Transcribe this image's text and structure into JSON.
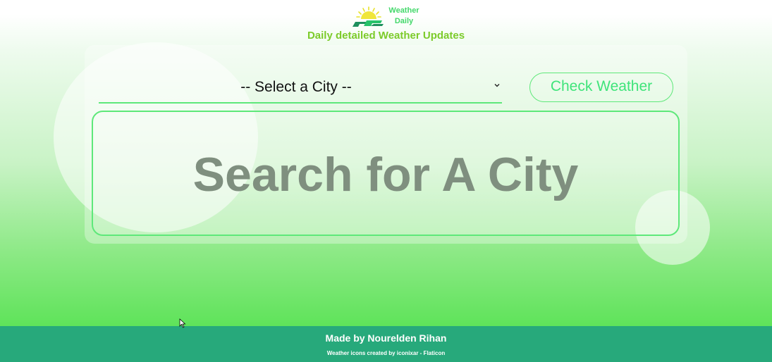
{
  "header": {
    "logo_line1": "Weather",
    "logo_line2": "Daily",
    "tagline": "Daily detailed Weather Updates"
  },
  "form": {
    "city_select_value": "-- Select a City --",
    "check_button_label": "Check Weather"
  },
  "result": {
    "message": "Search for A City"
  },
  "footer": {
    "made_by": "Made by Nourelden Rihan",
    "credit": "Weather icons created by iconixar - Flaticon"
  },
  "icons": {
    "logo": "sun-cloud-logo-icon",
    "select": "chevron-down-icon",
    "cursor": "mouse-cursor-icon"
  },
  "colors": {
    "accent_green": "#5ee87a",
    "tagline_green": "#7ccb2a",
    "footer_bg": "#27a97b",
    "placeholder_gray": "#7f8f7f"
  }
}
